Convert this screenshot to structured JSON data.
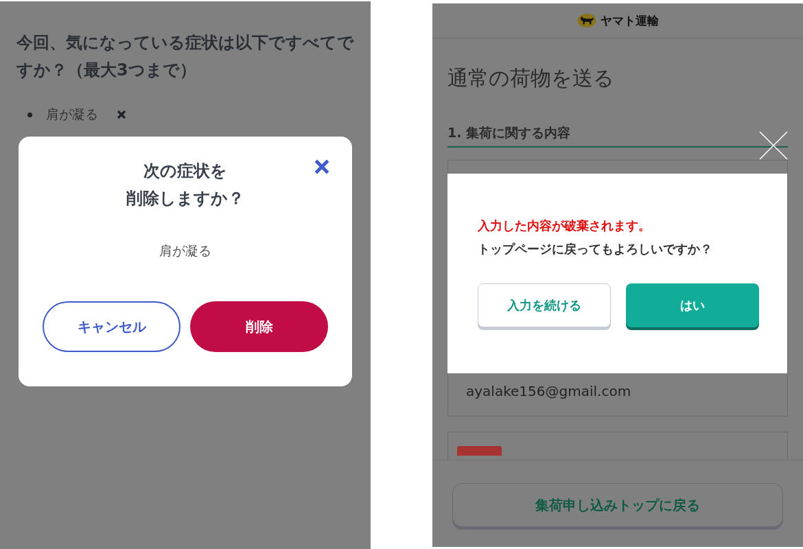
{
  "left_screen": {
    "question": "今回、気になっている症状は以下ですべてですか？（最大3つまで）",
    "selected_symptoms": [
      {
        "label": "肩が凝る"
      }
    ],
    "dialog": {
      "title_lines": [
        "次の症状を",
        "削除しますか？"
      ],
      "symptom": "肩が凝る",
      "buttons": [
        {
          "label": "キャンセル",
          "kind": "secondary"
        },
        {
          "label": "削除",
          "kind": "danger"
        }
      ]
    }
  },
  "right_screen": {
    "brand": "ヤマト運輸",
    "title": "通常の荷物を送る",
    "section_heading": "1. 集荷に関する内容",
    "email": "ayalake156@gmail.com",
    "footer_button": "集荷申し込みトップに戻る",
    "dialog": {
      "warning": "入力した内容が破棄されます。",
      "question": "トップページに戻ってもよろしいですか？",
      "buttons": [
        {
          "label": "入力を続ける",
          "kind": "secondary"
        },
        {
          "label": "はい",
          "kind": "primary"
        }
      ]
    }
  }
}
